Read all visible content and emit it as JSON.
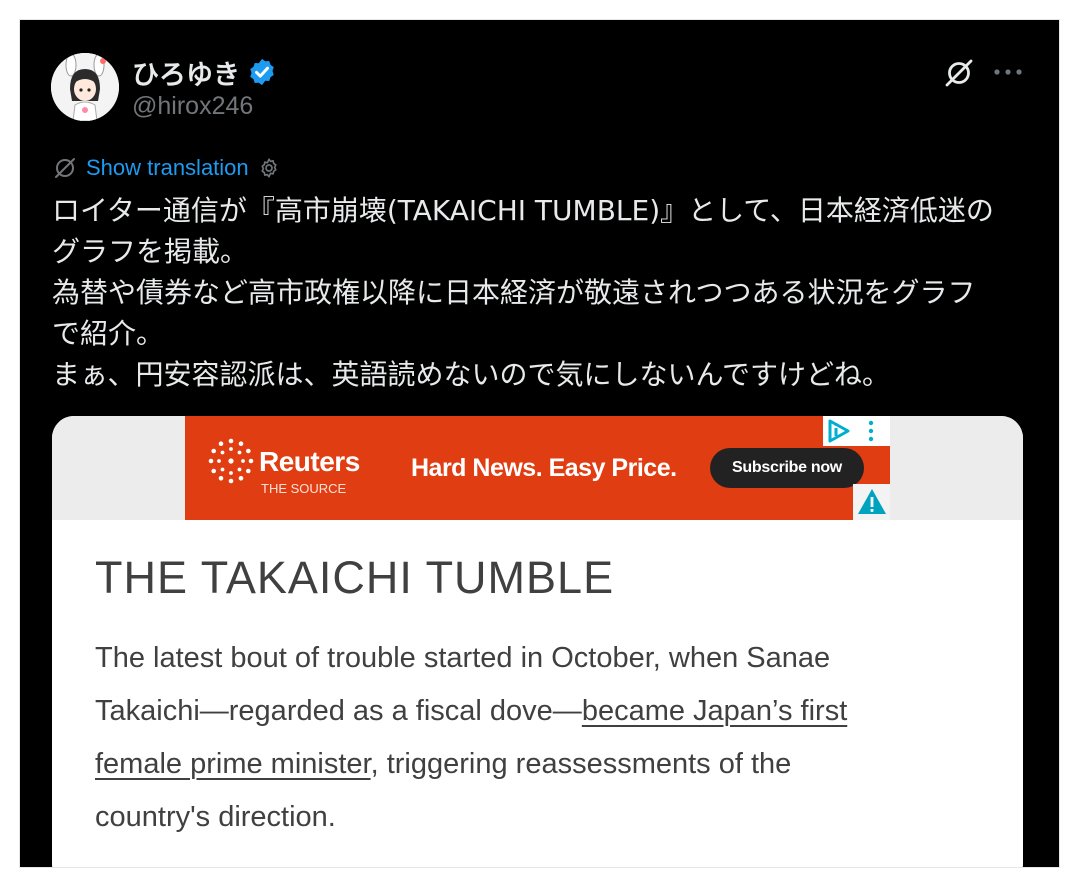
{
  "author": {
    "display_name": "ひろゆき",
    "handle": "@hirox246",
    "verified": true,
    "verified_color": "#1d9bf0"
  },
  "translate": {
    "link_label": "Show translation",
    "link_color": "#1d9bf0"
  },
  "tweet": {
    "lines": [
      "ロイター通信が『高市崩壊(TAKAICHI TUMBLE)』として、日本経済低迷の",
      "グラフを掲載。",
      "為替や債券など高市政権以降に日本経済が敬遠されつつある状況をグラフ",
      "で紹介。",
      "まぁ、円安容認派は、英語読めないので気にしないんですけどね。"
    ]
  },
  "card": {
    "ad": {
      "brand": "Reuters",
      "sub_brand": "THE SOURCE",
      "headline": "Hard News. Easy Price.",
      "cta": "Subscribe now",
      "background": "#e03d12"
    },
    "article": {
      "title": "THE TAKAICHI TUMBLE",
      "line1": "The latest bout of trouble started in October, when Sanae",
      "line2_pre": "Takaichi—regarded as a fiscal dove—",
      "line2_link": "became Japan’s first",
      "line3_link": "female prime minister",
      "line3_post": ", triggering reassessments of the",
      "line4": "country's direction."
    }
  },
  "icons": {
    "avatar": "avatar-illustration",
    "verified": "verified-badge-icon",
    "grok": "grok-icon",
    "more": "more-options-icon",
    "translate": "translate-icon",
    "settings": "gear-icon",
    "ad_choices": "ad-choices-icon",
    "ad_warning": "warning-icon"
  },
  "colors": {
    "background": "#000000",
    "text": "#e7e9ea",
    "secondary_text": "#71767b"
  }
}
